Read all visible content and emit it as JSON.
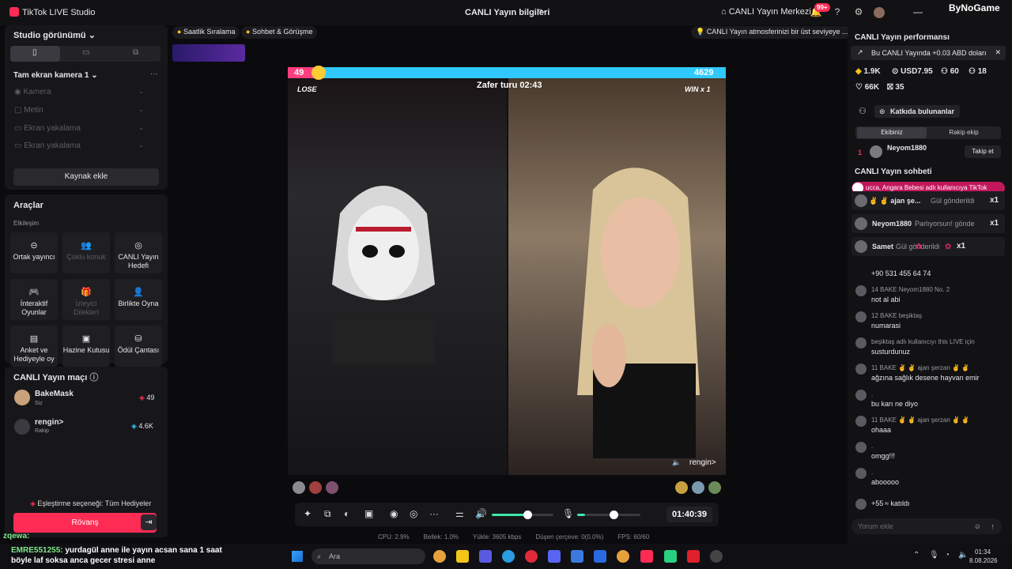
{
  "app": {
    "title": "TikTok LIVE Studio",
    "brand": "ByNoGame"
  },
  "header": {
    "live_info": "CANLI Yayın bilgileri",
    "live_center": "CANLI Yayın Merkezi",
    "notif_count": "99+"
  },
  "left": {
    "studio_title": "Studio görünümü",
    "camera_title": "Tam ekran kamera 1",
    "sources": [
      "Kamera",
      "Metin",
      "Ekran yakalama",
      "Ekran yakalama"
    ],
    "add_source": "Kaynak ekle",
    "tools_title": "Araçlar",
    "tools_sub": "Etkileşim",
    "tools": [
      {
        "label": "Ortak yayıncı",
        "icon": "link-icon",
        "glyph": "⊝",
        "dim": false
      },
      {
        "label": "Çoklu konuk",
        "icon": "guests-icon",
        "glyph": "👥",
        "dim": true
      },
      {
        "label": "CANLI Yayın Hedefi",
        "icon": "target-icon",
        "glyph": "◎",
        "dim": false
      },
      {
        "label": "İnteraktif Oyunlar",
        "icon": "gamepad-icon",
        "glyph": "🎮",
        "dim": false
      },
      {
        "label": "İzleyici Dilekleri",
        "icon": "gift-wish-icon",
        "glyph": "🎁",
        "dim": true
      },
      {
        "label": "Birlikte Oyna",
        "icon": "person-icon",
        "glyph": "👤",
        "dim": false
      },
      {
        "label": "Anket ve Hediyeyle oy",
        "icon": "poll-icon",
        "glyph": "▤",
        "dim": false
      },
      {
        "label": "Hazine Kutusu",
        "icon": "treasure-icon",
        "glyph": "▣",
        "dim": false
      },
      {
        "label": "Ödül Çantası",
        "icon": "bag-icon",
        "glyph": "⛁",
        "dim": false
      }
    ],
    "match_title": "CANLI Yayın maçı",
    "players": [
      {
        "name": "BakeMask",
        "role": "Siz",
        "score": "49"
      },
      {
        "name": "rengin>",
        "role": "Rakip",
        "score": "4.6K"
      }
    ],
    "match_option": "Eşleştirme seçeneği: Tüm Hediyeler",
    "rematch": "Rövanş"
  },
  "center": {
    "chips": [
      "Saatlik Sıralama",
      "Sohbet & Görüşme"
    ],
    "hint": "CANLI Yayın atmosferinizi bir üst seviyeye ...",
    "score_left": "49",
    "score_right": "4629",
    "victory_timer": "Zafer turu 02:43",
    "lose": "LOSE",
    "win": "WIN x 1",
    "opponent": "rengin>",
    "time": "01:40:39",
    "stats": [
      "CPU: 2.9%",
      "Bellek: 1.0%",
      "Yükle: 3605 kbps",
      "Düşen çerçeve: 0(0.0%)",
      "FPS: 60/60"
    ]
  },
  "right": {
    "perf_title": "CANLI Yayın performansı",
    "perf_banner": "Bu CANLI Yayında +0.03 ABD doları",
    "stats": [
      "1.9K",
      "USD7.95",
      "60",
      "18",
      "66K",
      "35"
    ],
    "contributors": "Katkıda bulunanlar",
    "team_mine": "Ekibiniz",
    "team_rival": "Rakip ekip",
    "top_rank": "1",
    "top_name": "Neyom1880",
    "follow": "Takip et",
    "chat_title": "CANLI Yayın sohbeti",
    "notice": "ucca, Angara Bebesi adlı kullanıcıya TikTok",
    "gifts": [
      {
        "name": "✌ ✌ ajan şe...",
        "text": "Gül gönderildi",
        "count": "x1"
      },
      {
        "name": "Neyom1880",
        "text": "Parlıyorsun! gönde",
        "count": "x1"
      },
      {
        "name": "Samet",
        "text": "Gül gönderildi",
        "count": "x1"
      }
    ],
    "messages": [
      {
        "head": "",
        "text": "+90 531 455 64 74"
      },
      {
        "head": "14  BAKE  Neyom1880  No. 2",
        "text": "not al abi"
      },
      {
        "head": "12  BAKE  beşiktaş",
        "text": "numarasi"
      },
      {
        "head": "beşiktaş adlı kullanıcıyı this LIVE için",
        "text": "susturdunuz"
      },
      {
        "head": "11  BAKE  ✌ ✌ ajan şerzan ✌ ✌",
        "text": "ağzına sağlık desene hayvan emir"
      },
      {
        "head": ".",
        "text": "bu karı ne diyo"
      },
      {
        "head": "11  BAKE  ✌ ✌ ajan şerzan ✌ ✌",
        "text": "ohaaa"
      },
      {
        "head": ".",
        "text": "omgg!!!"
      },
      {
        "head": ".",
        "text": "abooooo"
      },
      {
        "head": "",
        "text": "+55 ≈  katıldı"
      }
    ],
    "comment_placeholder": "Yorum ekle"
  },
  "taskbar": {
    "search": "Ara",
    "time": "01:34",
    "date": "8.08.2026"
  },
  "overlay_chat": [
    {
      "name": "zqewa:",
      "text": ""
    },
    {
      "name": "EMRE551255:",
      "text": "yurdagül anne ile yayın acsan sana 1 saat"
    },
    {
      "name": "",
      "text": "böyle laf soksa anca gecer stresi anne"
    }
  ],
  "colors": {
    "accent": "#fe2c55",
    "score_pink": "#ff3d7f",
    "score_blue": "#2fc9ff",
    "panel": "#17171a"
  }
}
